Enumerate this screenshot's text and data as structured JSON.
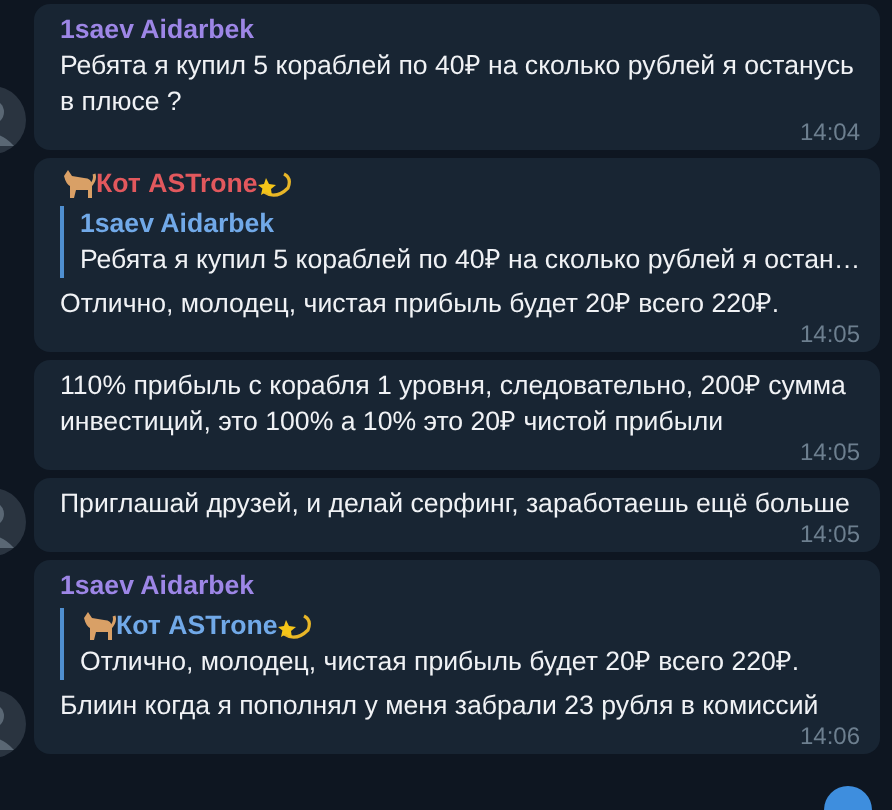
{
  "messages": [
    {
      "author": {
        "name": "1saev Aidarbek",
        "color": "#9d86e6",
        "decorated": false
      },
      "text": "Ребята я купил 5 кораблей по 40₽ на сколько рублей я останусь в плюсе ?",
      "time": "14:04",
      "avatar": true
    },
    {
      "author": {
        "name": "Кот ASTrone",
        "color": "#e2585d",
        "decorated": true
      },
      "reply": {
        "author": "1saev Aidarbek",
        "decorated": false,
        "text": "Ребята я купил 5 кораблей по 40₽ на сколько рублей я остан…"
      },
      "text": "Отлично, молодец, чистая прибыль будет 20₽ всего 220₽.",
      "time": "14:05",
      "avatar": false
    },
    {
      "text": "110% прибыль с корабля 1 уровня, следовательно, 200₽ сумма инвестиций, это 100% а 10% это 20₽ чистой прибыли",
      "time": "14:05",
      "avatar": false
    },
    {
      "text": "Приглашай друзей, и делай серфинг, заработаешь ещё больше",
      "time": "14:05",
      "avatar": true
    },
    {
      "author": {
        "name": "1saev Aidarbek",
        "color": "#9d86e6",
        "decorated": false
      },
      "reply": {
        "author": "Кот ASTrone",
        "decorated": true,
        "text": "Отлично, молодец, чистая прибыль будет 20₽ всего 220₽."
      },
      "text": "Блиин когда я пополнял у меня забрали 23 рубля в комиссий",
      "time": "14:06",
      "avatar": true
    }
  ]
}
